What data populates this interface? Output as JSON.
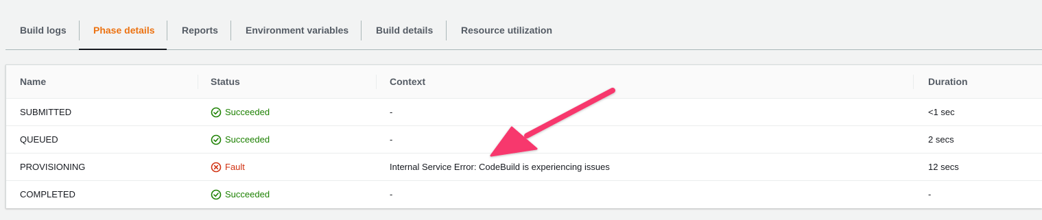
{
  "tabs": [
    {
      "label": "Build logs",
      "active": false
    },
    {
      "label": "Phase details",
      "active": true
    },
    {
      "label": "Reports",
      "active": false
    },
    {
      "label": "Environment variables",
      "active": false
    },
    {
      "label": "Build details",
      "active": false
    },
    {
      "label": "Resource utilization",
      "active": false
    }
  ],
  "table": {
    "columns": [
      "Name",
      "Status",
      "Context",
      "Duration"
    ],
    "rows": [
      {
        "name": "SUBMITTED",
        "status": "Succeeded",
        "status_kind": "success",
        "context": "-",
        "duration": "<1 sec"
      },
      {
        "name": "QUEUED",
        "status": "Succeeded",
        "status_kind": "success",
        "context": "-",
        "duration": "2 secs"
      },
      {
        "name": "PROVISIONING",
        "status": "Fault",
        "status_kind": "fault",
        "context": "Internal Service Error: CodeBuild is experiencing issues",
        "duration": "12 secs"
      },
      {
        "name": "COMPLETED",
        "status": "Succeeded",
        "status_kind": "success",
        "context": "-",
        "duration": "-"
      }
    ]
  },
  "icons": {
    "success": "check-circle-icon",
    "fault": "x-circle-icon"
  },
  "annotation": {
    "type": "arrow",
    "color": "#f7376d",
    "points_to": "PROVISIONING context"
  },
  "colors": {
    "active_tab": "#ec7211",
    "success": "#1d8102",
    "fault": "#d13212"
  }
}
